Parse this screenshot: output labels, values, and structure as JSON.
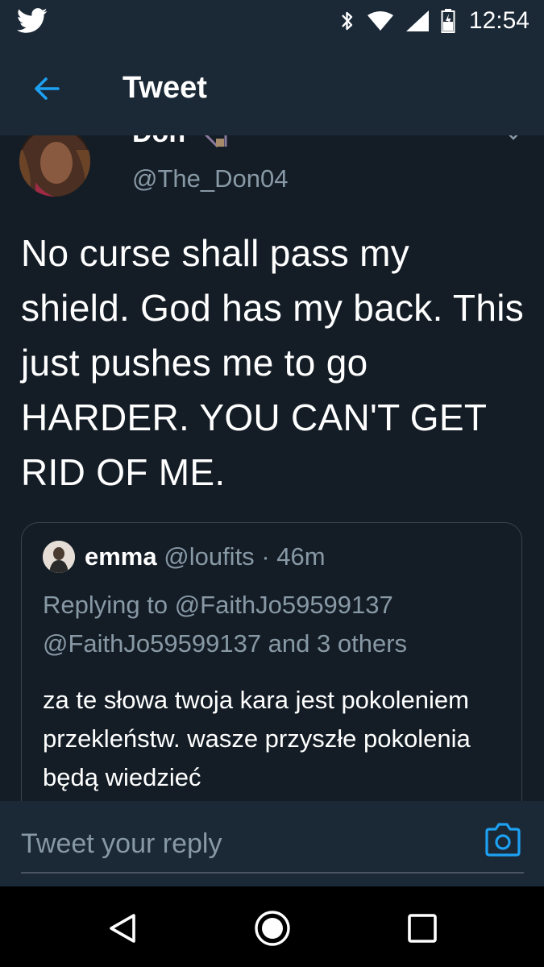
{
  "status_bar": {
    "time": "12:54",
    "icons": [
      "twitter-bird-icon",
      "bluetooth-icon",
      "wifi-icon",
      "signal-icon",
      "battery-icon"
    ]
  },
  "app_bar": {
    "title": "Tweet",
    "back_icon": "back-arrow-icon"
  },
  "tweet": {
    "author_name_partial": "Don",
    "author_handle": "@The_Don04",
    "text": "No curse shall pass my shield. God has my back. This just pushes me to go HARDER. YOU CAN'T GET RID OF ME.",
    "quoted": {
      "name": "emma",
      "handle": "@loufits",
      "time": "· 46m",
      "replying_to": "Replying to @FaithJo59599137 @FaithJo59599137 and 3 others",
      "text": "za te słowa twoja kara jest pokoleniem przekleństw. wasze przyszłe pokolenia będą wiedzieć"
    }
  },
  "reply_bar": {
    "placeholder": "Tweet your reply",
    "camera_icon": "camera-icon"
  },
  "nav_bar": {
    "buttons": [
      "back-triangle-icon",
      "home-circle-icon",
      "recents-square-icon"
    ]
  },
  "colors": {
    "background": "#141d26",
    "bar": "#1b2836",
    "accent": "#1da1f2",
    "secondary_text": "#8899a6"
  }
}
